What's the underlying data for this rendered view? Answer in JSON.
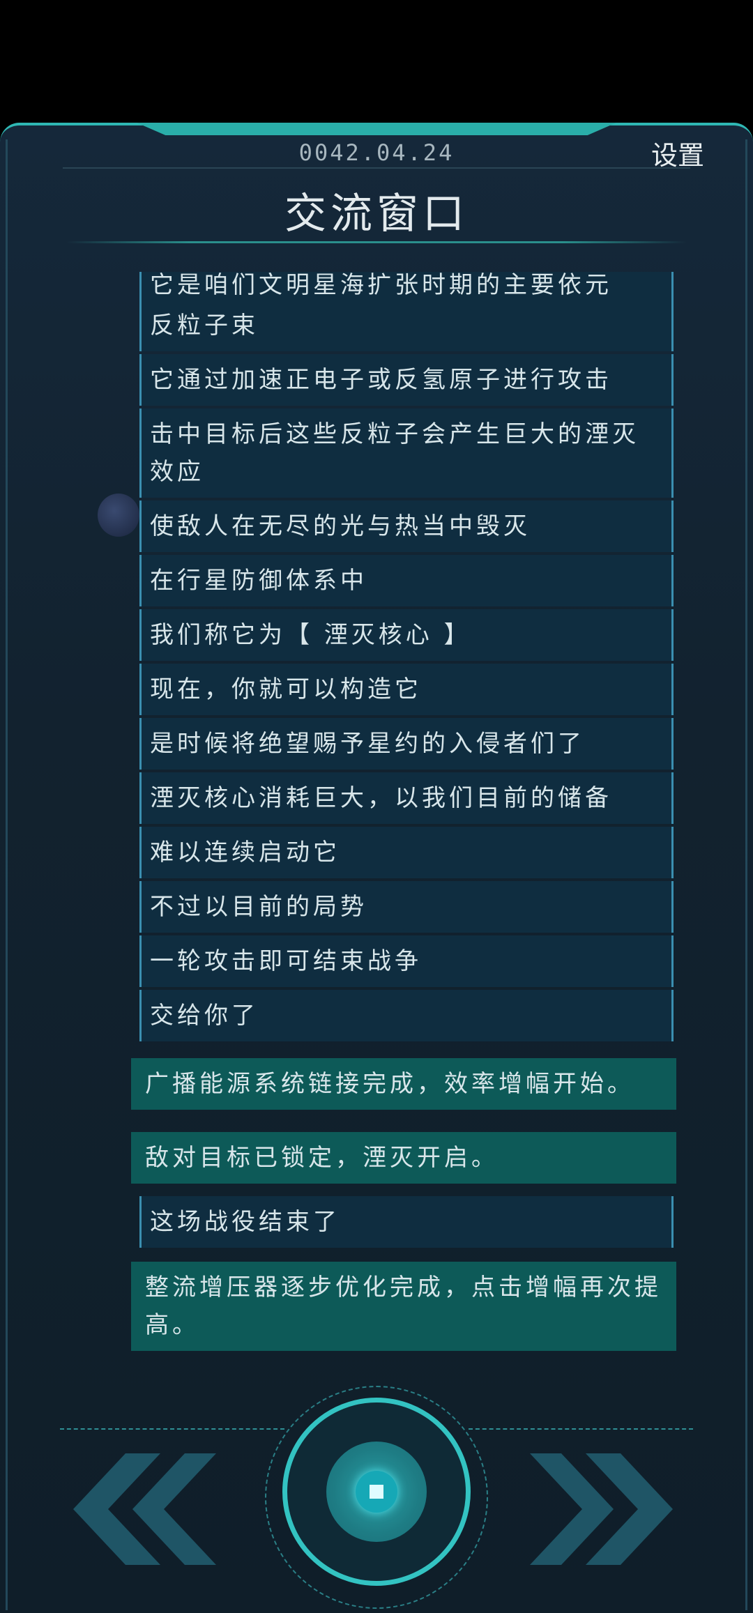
{
  "header": {
    "date": "0042.04.24",
    "settings_label": "设置",
    "title": "交流窗口"
  },
  "messages": [
    {
      "text": "它是咱们文明星海扩张时期的主要依元",
      "type": "normal"
    },
    {
      "text": "反粒子束",
      "type": "normal"
    },
    {
      "text": "它通过加速正电子或反氢原子进行攻击",
      "type": "normal"
    },
    {
      "text": "击中目标后这些反粒子会产生巨大的湮灭效应",
      "type": "normal"
    },
    {
      "text": "使敌人在无尽的光与热当中毁灭",
      "type": "normal"
    },
    {
      "text": "在行星防御体系中",
      "type": "normal"
    },
    {
      "text": "我们称它为【 湮灭核心 】",
      "type": "normal"
    },
    {
      "text": "现在，你就可以构造它",
      "type": "normal"
    },
    {
      "text": "是时候将绝望赐予星约的入侵者们了",
      "type": "normal"
    },
    {
      "text": "湮灭核心消耗巨大，以我们目前的储备",
      "type": "normal"
    },
    {
      "text": "难以连续启动它",
      "type": "normal"
    },
    {
      "text": "不过以目前的局势",
      "type": "normal"
    },
    {
      "text": "一轮攻击即可结束战争",
      "type": "normal"
    },
    {
      "text": "交给你了",
      "type": "normal"
    },
    {
      "text": "广播能源系统链接完成，效率增幅开始。",
      "type": "system"
    },
    {
      "text": "敌对目标已锁定，湮灭开启。",
      "type": "system"
    },
    {
      "text": "这场战役结束了",
      "type": "normal"
    },
    {
      "text": "整流增压器逐步优化完成，点击增幅再次提高。",
      "type": "system"
    }
  ],
  "controls": {
    "prev_icon": "double-chevron-left-icon",
    "next_icon": "double-chevron-right-icon",
    "main_icon": "core-button-icon"
  },
  "colors": {
    "accent": "#2fb8b4",
    "system_bubble": "#0d5a58",
    "normal_bubble": "#0f2d40",
    "background": "#12222f"
  }
}
